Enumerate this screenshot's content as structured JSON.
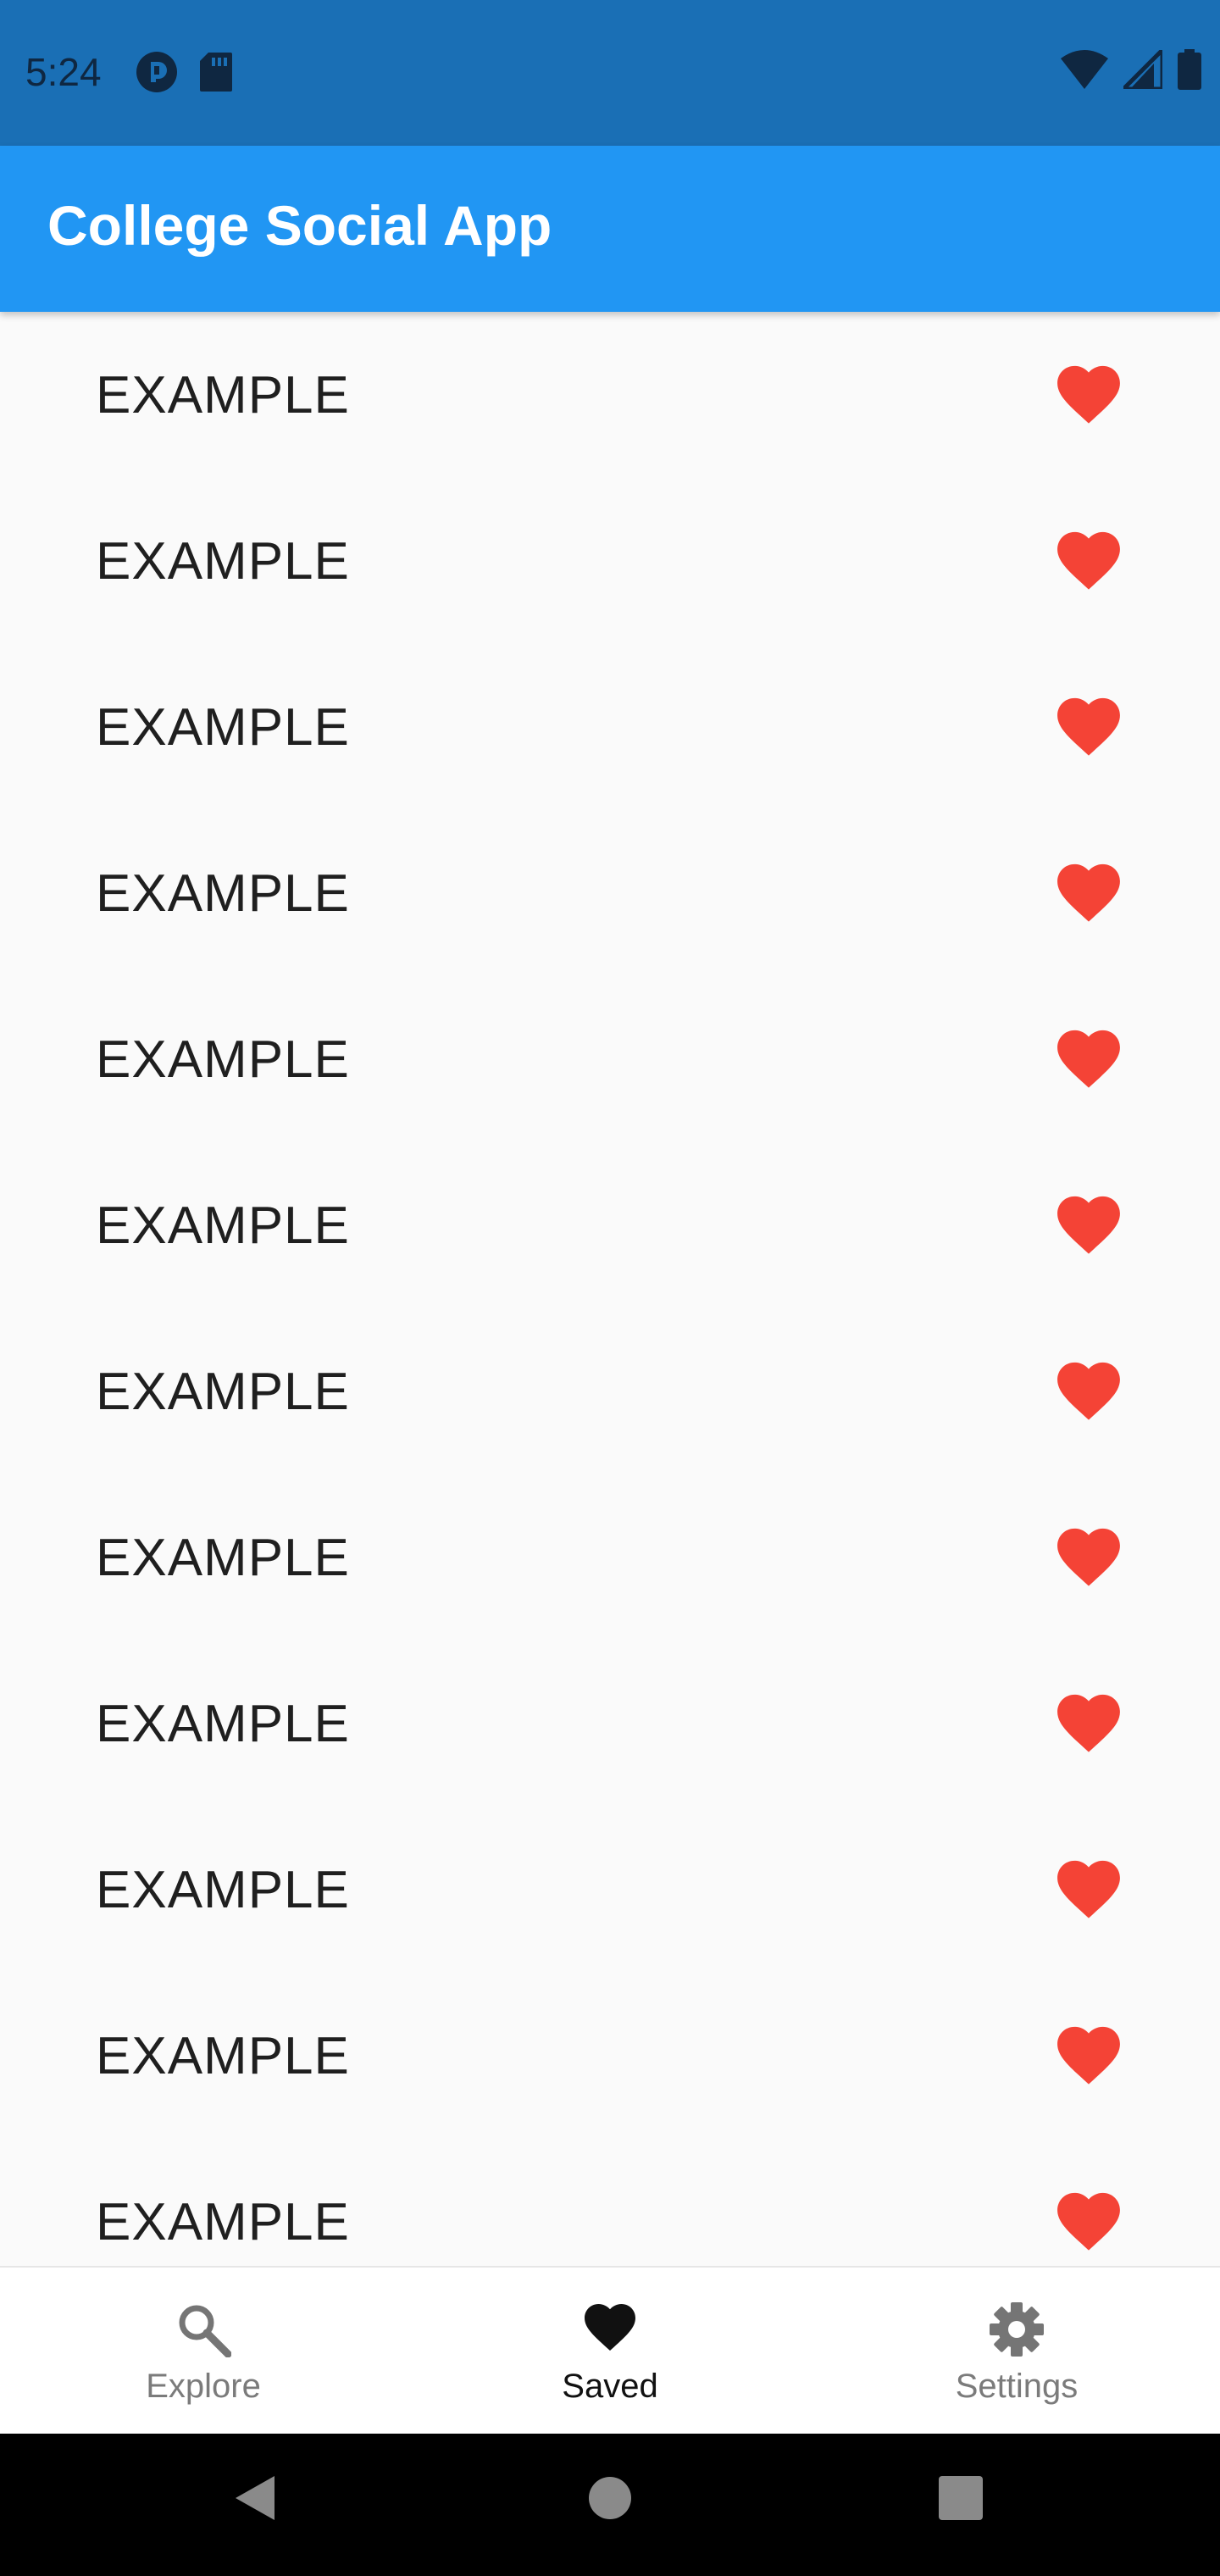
{
  "status_bar": {
    "time": "5:24",
    "left_icons": [
      "pocket-casts-icon",
      "sd-card-icon"
    ],
    "right_icons": [
      "wifi-icon",
      "cell-signal-icon",
      "battery-icon"
    ]
  },
  "app_bar": {
    "title": "College Social App",
    "color": "#2196f3"
  },
  "list": {
    "items": [
      {
        "label": "EXAMPLE",
        "saved": true
      },
      {
        "label": "EXAMPLE",
        "saved": true
      },
      {
        "label": "EXAMPLE",
        "saved": true
      },
      {
        "label": "EXAMPLE",
        "saved": true
      },
      {
        "label": "EXAMPLE",
        "saved": true
      },
      {
        "label": "EXAMPLE",
        "saved": true
      },
      {
        "label": "EXAMPLE",
        "saved": true
      },
      {
        "label": "EXAMPLE",
        "saved": true
      },
      {
        "label": "EXAMPLE",
        "saved": true
      },
      {
        "label": "EXAMPLE",
        "saved": true
      },
      {
        "label": "EXAMPLE",
        "saved": true
      },
      {
        "label": "EXAMPLE",
        "saved": true
      }
    ],
    "heart_color": "#f44336"
  },
  "bottom_nav": {
    "items": [
      {
        "label": "Explore",
        "icon": "search-icon",
        "active": false
      },
      {
        "label": "Saved",
        "icon": "heart-icon",
        "active": true
      },
      {
        "label": "Settings",
        "icon": "gear-icon",
        "active": false
      }
    ]
  },
  "system_nav": {
    "buttons": [
      "back-icon",
      "home-icon",
      "recents-icon"
    ]
  }
}
